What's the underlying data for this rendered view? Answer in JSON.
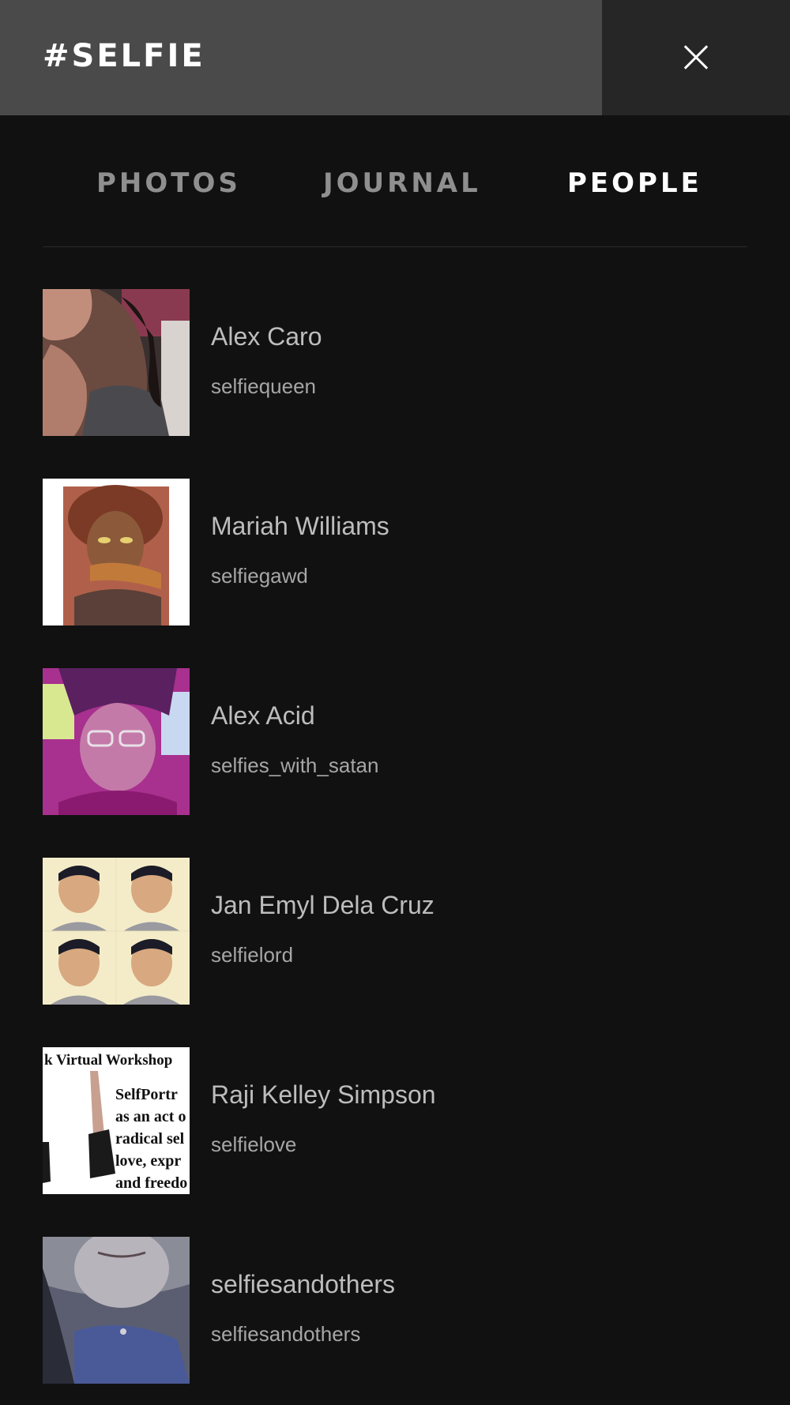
{
  "header": {
    "title": "#SELFIE",
    "close_icon": "close-icon"
  },
  "tabs": [
    {
      "label": "PHOTOS",
      "active": false
    },
    {
      "label": "JOURNAL",
      "active": false
    },
    {
      "label": "PEOPLE",
      "active": true
    }
  ],
  "people": [
    {
      "name": "Alex Caro",
      "handle": "selfiequeen"
    },
    {
      "name": "Mariah Williams",
      "handle": "selfiegawd"
    },
    {
      "name": "Alex Acid",
      "handle": "selfies_with_satan"
    },
    {
      "name": "Jan Emyl Dela Cruz",
      "handle": "selfielord"
    },
    {
      "name": "Raji Kelley Simpson",
      "handle": "selfielove"
    },
    {
      "name": "selfiesandothers",
      "handle": "selfiesandothers"
    }
  ],
  "workshop_thumbnail": {
    "heading": "k Virtual Workshop",
    "lines": [
      "SelfPortr",
      "as an act o",
      "radical sel",
      "love, expr",
      "and freedo"
    ]
  },
  "colors": {
    "background": "#111111",
    "header_title_bg": "#4a4a4a",
    "close_bg": "#262626",
    "tab_inactive": "#8f8f8f",
    "tab_active": "#ffffff",
    "name_text": "#bdbdbd"
  }
}
